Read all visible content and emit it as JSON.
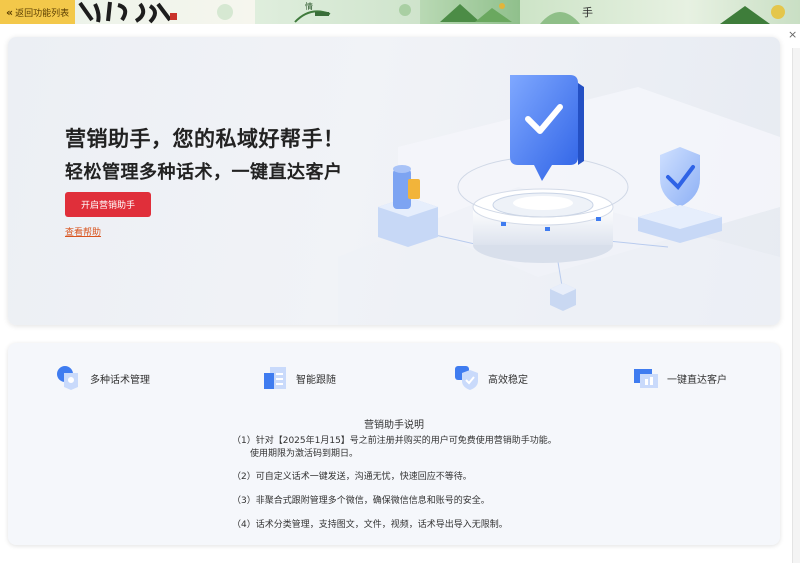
{
  "nav": {
    "back_label": "返回功能列表",
    "close_symbol": "×"
  },
  "hero": {
    "title_line1": "营销助手，您的私域好帮手！",
    "title_line2": "轻松管理多种话术，一键直达客户",
    "start_button": "开启营销助手",
    "help_link": "查看帮助"
  },
  "features": [
    {
      "icon": "chat-shield-icon",
      "label": "多种话术管理"
    },
    {
      "icon": "document-list-icon",
      "label": "智能跟随"
    },
    {
      "icon": "shield-badge-icon",
      "label": "高效稳定"
    },
    {
      "icon": "contact-card-icon",
      "label": "一键直达客户"
    }
  ],
  "description": {
    "title": "营销助手说明",
    "items": [
      {
        "line": "（1）针对【2025年1月15】号之前注册并购买的用户可免费使用营销助手功能。",
        "sub": "使用期限为激活码到期日。"
      },
      {
        "line": "（2）可自定义话术一键发送，沟通无忧，快速回应不等待。"
      },
      {
        "line": "（3）非聚合式跟附管理多个微信，确保微信信息和账号的安全。"
      },
      {
        "line": "（4）话术分类管理，支持图文，文件，视频，话术导出导入无限制。"
      }
    ]
  },
  "colors": {
    "accent_red": "#e02f3a",
    "link_orange": "#d9541e",
    "back_yellow": "#f3c84a",
    "icon_blue": "#3f7cf0"
  }
}
